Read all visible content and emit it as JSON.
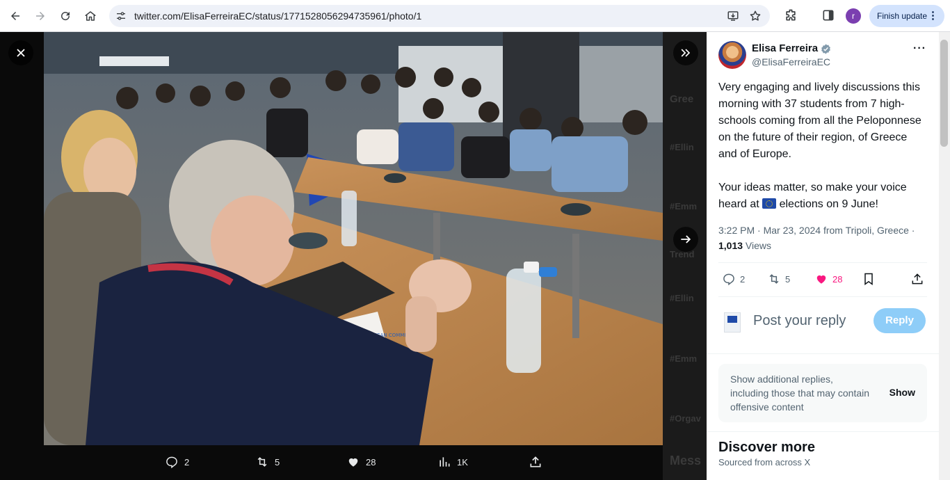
{
  "browser": {
    "url": "twitter.com/ElisaFerreiraEC/status/1771528056294735961/photo/1",
    "profile_initial": "r",
    "finish_update_label": "Finish update"
  },
  "media": {
    "background_texts": [
      "Gree",
      "#Ellin",
      "#Emm",
      "Trend",
      "#Ellin",
      "#Emm",
      "#Orgav",
      "Mess"
    ],
    "stats": {
      "replies": "2",
      "reposts": "5",
      "likes": "28",
      "views": "1K"
    },
    "photo_booklet_text": "EUROPEAN COMMISSION"
  },
  "tweet": {
    "author_name": "Elisa Ferreira",
    "author_handle": "@ElisaFerreiraEC",
    "text_p1": "Very engaging and lively discussions this morning with 37 students from 7 high-schools coming from all the Peloponnese on the future of their region, of Greece and of Europe.",
    "text_p2_before": "Your ideas matter, so make your voice heard at ",
    "text_p2_after": " elections on 9 June!",
    "meta_time": "3:22 PM · Mar 23, 2024 from Tripoli, Greece · ",
    "views_count": "1,013",
    "views_label": " Views",
    "counts": {
      "replies": "2",
      "reposts": "5",
      "likes": "28"
    },
    "like_color": "#f91880"
  },
  "reply": {
    "placeholder": "Post your reply",
    "button": "Reply"
  },
  "additional_replies": {
    "text": "Show additional replies, including those that may contain offensive content",
    "button": "Show"
  },
  "discover": {
    "title": "Discover more",
    "subtitle": "Sourced from across X"
  }
}
